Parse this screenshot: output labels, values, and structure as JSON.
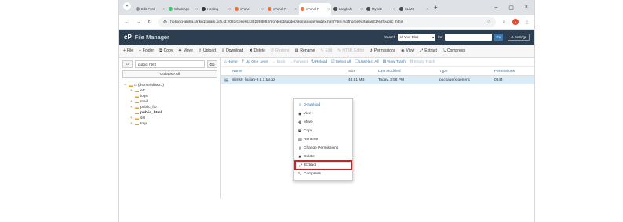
{
  "browser": {
    "tabs": [
      {
        "label": "Edit Post",
        "favicon_color": "#8f8f8f",
        "active": false
      },
      {
        "label": "WhatsApp",
        "favicon_color": "#25d366",
        "active": false
      },
      {
        "label": "Hosting",
        "favicon_color": "#333333",
        "active": false
      },
      {
        "label": "cPanel",
        "favicon_color": "#ff6c2c",
        "active": false
      },
      {
        "label": "cPanel F",
        "favicon_color": "#ff6c2c",
        "active": false
      },
      {
        "label": "cPanel F",
        "favicon_color": "#ff6c2c",
        "active": true
      },
      {
        "label": "Langkah",
        "favicon_color": "#4a4a4a",
        "active": false
      },
      {
        "label": "My site",
        "favicon_color": "#4a4a4a",
        "active": false
      },
      {
        "label": "SLiMS",
        "favicon_color": "#4a4a4a",
        "active": false
      }
    ],
    "tab_close": "×",
    "new_tab": "+",
    "window_controls": [
      "–",
      "▢",
      "×"
    ],
    "url": "hosting-alpha.smkn1kalam.sch.id:2083/cpsess4392268052/frontend/jupiter/filemanager/index.html?dir=%2fhome%2falias21%2fpublic_html",
    "profile_initial": "A"
  },
  "cpanel": {
    "title": "File Manager",
    "logo": "cP",
    "search_label": "Search",
    "search_scope": "All Your Files",
    "for_label": "for",
    "go_label": "Go",
    "settings_label": "Settings",
    "toolbar": [
      {
        "icon": "+",
        "label": "File",
        "enabled": true
      },
      {
        "icon": "+",
        "label": "Folder",
        "enabled": true
      },
      {
        "icon": "⧉",
        "label": "Copy",
        "enabled": true
      },
      {
        "icon": "✥",
        "label": "Move",
        "enabled": true
      },
      {
        "icon": "⇧",
        "label": "Upload",
        "enabled": true
      },
      {
        "icon": "⇩",
        "label": "Download",
        "enabled": true
      },
      {
        "icon": "✖",
        "label": "Delete",
        "enabled": true
      },
      {
        "icon": "↺",
        "label": "Restore",
        "enabled": false
      },
      {
        "icon": "▤",
        "label": "Rename",
        "enabled": true
      },
      {
        "icon": "✎",
        "label": "Edit",
        "enabled": false
      },
      {
        "icon": "✎",
        "label": "HTML Editor",
        "enabled": false
      },
      {
        "icon": "⚷",
        "label": "Permissions",
        "enabled": true
      },
      {
        "icon": "◉",
        "label": "View",
        "enabled": true
      },
      {
        "icon": "⤢",
        "label": "Extract",
        "enabled": true
      },
      {
        "icon": "⤡",
        "label": "Compress",
        "enabled": true
      }
    ],
    "path_value": "public_html",
    "path_go": "Go",
    "collapse_all": "Collapse All",
    "tree": [
      {
        "toggle": "−",
        "label": "(/home/alias21)",
        "depth": 0,
        "current": false,
        "home": true
      },
      {
        "toggle": "+",
        "label": "etc",
        "depth": 1,
        "current": false
      },
      {
        "toggle": "",
        "label": "logs",
        "depth": 1,
        "current": false
      },
      {
        "toggle": "+",
        "label": "mail",
        "depth": 1,
        "current": false
      },
      {
        "toggle": "+",
        "label": "public_ftp",
        "depth": 1,
        "current": false
      },
      {
        "toggle": "",
        "label": "public_html",
        "depth": 1,
        "current": true
      },
      {
        "toggle": "+",
        "label": "ssl",
        "depth": 1,
        "current": false
      },
      {
        "toggle": "+",
        "label": "tmp",
        "depth": 1,
        "current": false
      }
    ],
    "file_toolbar": [
      {
        "icon": "⌂",
        "label": "Home",
        "enabled": true
      },
      {
        "icon": "⇡",
        "label": "Up One Level",
        "enabled": true
      },
      {
        "icon": "←",
        "label": "Back",
        "enabled": false
      },
      {
        "icon": "→",
        "label": "Forward",
        "enabled": false
      },
      {
        "icon": "↻",
        "label": "Reload",
        "enabled": true
      },
      {
        "icon": "☑",
        "label": "Select All",
        "enabled": true
      },
      {
        "icon": "☐",
        "label": "Unselect All",
        "enabled": true
      },
      {
        "icon": "▤",
        "label": "View Trash",
        "enabled": true
      },
      {
        "icon": "▥",
        "label": "Empty Trash",
        "enabled": false
      }
    ],
    "columns": {
      "name": "Name",
      "size": "Size",
      "modified": "Last Modified",
      "type": "Type",
      "permissions": "Permissions"
    },
    "file": {
      "name": "slims9_bulian-9.6.1.tar.gz",
      "size": "46.81 MB",
      "modified": "Today, 2:58 PM",
      "type": "package/x-generic",
      "permissions": "0644"
    },
    "context_menu": [
      {
        "icon": "⇩",
        "label": "Download",
        "highlighted": false
      },
      {
        "icon": "◉",
        "label": "View",
        "highlighted": false
      },
      {
        "icon": "✥",
        "label": "Move",
        "highlighted": false
      },
      {
        "icon": "⧉",
        "label": "Copy",
        "highlighted": false
      },
      {
        "icon": "▤",
        "label": "Rename",
        "highlighted": false
      },
      {
        "icon": "⚷",
        "label": "Change Permissions",
        "highlighted": false
      },
      {
        "icon": "✖",
        "label": "Delete",
        "highlighted": false
      },
      {
        "icon": "⤢",
        "label": "Extract",
        "highlighted": true
      },
      {
        "icon": "⤡",
        "label": "Compress",
        "highlighted": false
      }
    ]
  }
}
